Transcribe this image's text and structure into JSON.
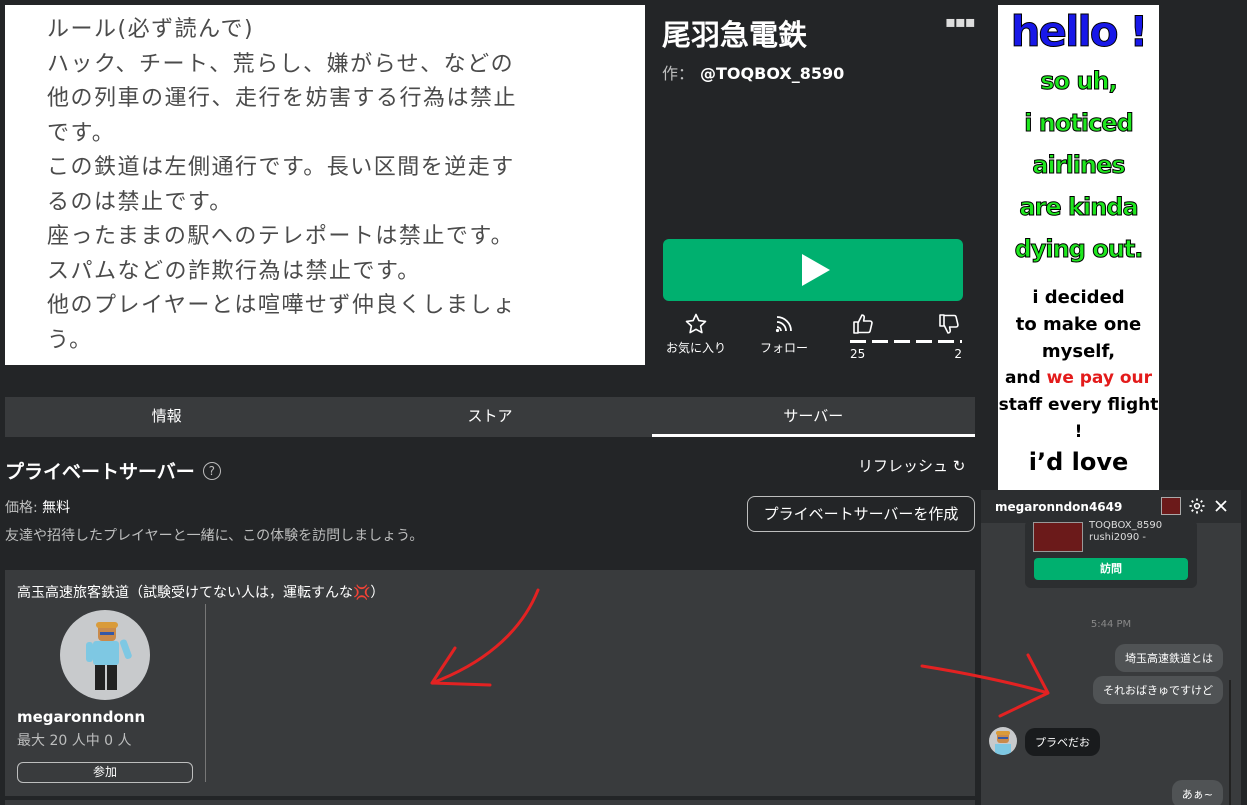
{
  "thumbnail": {
    "lines": [
      "ルール(必ず読んで)",
      "ハック、チート、荒らし、嫌がらせ、などの",
      "他の列車の運行、走行を妨害する行為は禁止",
      "です。",
      "この鉄道は左側通行です。長い区間を逆走す",
      "るのは禁止です。",
      "座ったままの駅へのテレポートは禁止です。",
      "スパムなどの詐欺行為は禁止です。",
      "他のプレイヤーとは喧嘩せず仲良くしましょ",
      "う。"
    ]
  },
  "game": {
    "title": "尾羽急電鉄",
    "author_prefix": "作：",
    "author": "@TOQBOX_8590",
    "more": "▪▪▪"
  },
  "actions": {
    "favorite": "お気に入り",
    "follow": "フォロー",
    "upvotes": "25",
    "downvotes": "2"
  },
  "tabs": [
    "情報",
    "ストア",
    "サーバー"
  ],
  "private_servers": {
    "heading": "プライベートサーバー",
    "help": "?",
    "refresh": "リフレッシュ ↻",
    "price_label": "価格:",
    "price_value": "無料",
    "description": "友達や招待したプレイヤーと一緒に、この体験を訪問しましょう。",
    "create_button": "プライベートサーバーを作成",
    "server": {
      "name": "高玉高速旅客鉄道（試験受けてない人は，運転すんな💢）",
      "owner": "megaronndonn",
      "capacity": "最大 20 人中 0 人",
      "join": "参加"
    }
  },
  "ad": {
    "hello": "hello !",
    "green": "so uh,\ni noticed\nairlines\nare kinda\ndying out.",
    "black": "i decided\nto make one\nmyself,",
    "and": "and ",
    "red1": "we pay our",
    "red2": "staff every flight !",
    "big": "i’d love"
  },
  "chat": {
    "username": "megaronndon4649",
    "share_line1": "TOQBOX_8590",
    "share_line2": "rushi2090 -",
    "visit": "訪問",
    "time": "5:44 PM",
    "messages": [
      {
        "from": "me",
        "text": "埼玉高速鉄道とは"
      },
      {
        "from": "me",
        "text": "それおばきゅですけど"
      },
      {
        "from": "them",
        "text": "プラベだお"
      },
      {
        "from": "me",
        "text": "あぁ~"
      }
    ]
  },
  "colors": {
    "play": "#00b06f",
    "background": "#232527",
    "panel": "#393b3d",
    "annotation": "#e32222"
  }
}
